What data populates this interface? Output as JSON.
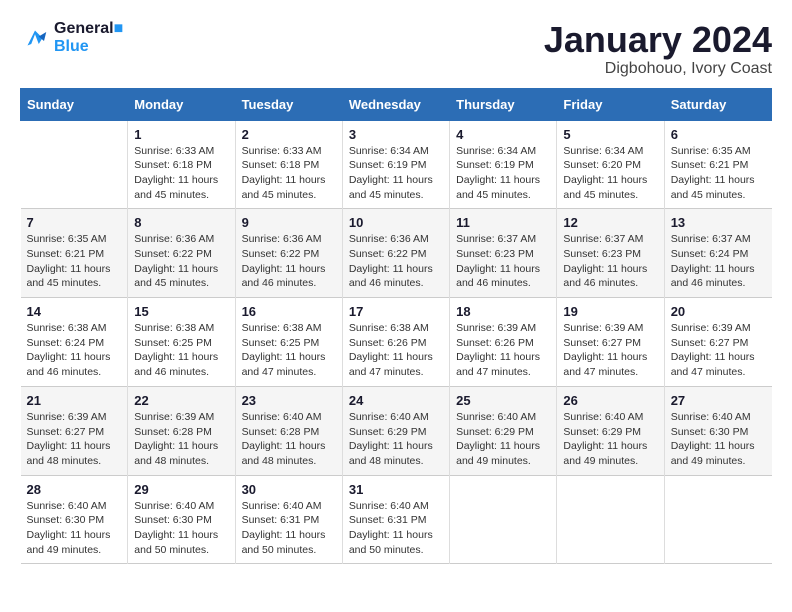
{
  "header": {
    "logo_line1": "General",
    "logo_line2": "Blue",
    "month": "January 2024",
    "location": "Digbohouo, Ivory Coast"
  },
  "weekdays": [
    "Sunday",
    "Monday",
    "Tuesday",
    "Wednesday",
    "Thursday",
    "Friday",
    "Saturday"
  ],
  "weeks": [
    [
      {
        "day": "",
        "info": ""
      },
      {
        "day": "1",
        "info": "Sunrise: 6:33 AM\nSunset: 6:18 PM\nDaylight: 11 hours and 45 minutes."
      },
      {
        "day": "2",
        "info": "Sunrise: 6:33 AM\nSunset: 6:18 PM\nDaylight: 11 hours and 45 minutes."
      },
      {
        "day": "3",
        "info": "Sunrise: 6:34 AM\nSunset: 6:19 PM\nDaylight: 11 hours and 45 minutes."
      },
      {
        "day": "4",
        "info": "Sunrise: 6:34 AM\nSunset: 6:19 PM\nDaylight: 11 hours and 45 minutes."
      },
      {
        "day": "5",
        "info": "Sunrise: 6:34 AM\nSunset: 6:20 PM\nDaylight: 11 hours and 45 minutes."
      },
      {
        "day": "6",
        "info": "Sunrise: 6:35 AM\nSunset: 6:21 PM\nDaylight: 11 hours and 45 minutes."
      }
    ],
    [
      {
        "day": "7",
        "info": "Sunrise: 6:35 AM\nSunset: 6:21 PM\nDaylight: 11 hours and 45 minutes."
      },
      {
        "day": "8",
        "info": "Sunrise: 6:36 AM\nSunset: 6:22 PM\nDaylight: 11 hours and 45 minutes."
      },
      {
        "day": "9",
        "info": "Sunrise: 6:36 AM\nSunset: 6:22 PM\nDaylight: 11 hours and 46 minutes."
      },
      {
        "day": "10",
        "info": "Sunrise: 6:36 AM\nSunset: 6:22 PM\nDaylight: 11 hours and 46 minutes."
      },
      {
        "day": "11",
        "info": "Sunrise: 6:37 AM\nSunset: 6:23 PM\nDaylight: 11 hours and 46 minutes."
      },
      {
        "day": "12",
        "info": "Sunrise: 6:37 AM\nSunset: 6:23 PM\nDaylight: 11 hours and 46 minutes."
      },
      {
        "day": "13",
        "info": "Sunrise: 6:37 AM\nSunset: 6:24 PM\nDaylight: 11 hours and 46 minutes."
      }
    ],
    [
      {
        "day": "14",
        "info": "Sunrise: 6:38 AM\nSunset: 6:24 PM\nDaylight: 11 hours and 46 minutes."
      },
      {
        "day": "15",
        "info": "Sunrise: 6:38 AM\nSunset: 6:25 PM\nDaylight: 11 hours and 46 minutes."
      },
      {
        "day": "16",
        "info": "Sunrise: 6:38 AM\nSunset: 6:25 PM\nDaylight: 11 hours and 47 minutes."
      },
      {
        "day": "17",
        "info": "Sunrise: 6:38 AM\nSunset: 6:26 PM\nDaylight: 11 hours and 47 minutes."
      },
      {
        "day": "18",
        "info": "Sunrise: 6:39 AM\nSunset: 6:26 PM\nDaylight: 11 hours and 47 minutes."
      },
      {
        "day": "19",
        "info": "Sunrise: 6:39 AM\nSunset: 6:27 PM\nDaylight: 11 hours and 47 minutes."
      },
      {
        "day": "20",
        "info": "Sunrise: 6:39 AM\nSunset: 6:27 PM\nDaylight: 11 hours and 47 minutes."
      }
    ],
    [
      {
        "day": "21",
        "info": "Sunrise: 6:39 AM\nSunset: 6:27 PM\nDaylight: 11 hours and 48 minutes."
      },
      {
        "day": "22",
        "info": "Sunrise: 6:39 AM\nSunset: 6:28 PM\nDaylight: 11 hours and 48 minutes."
      },
      {
        "day": "23",
        "info": "Sunrise: 6:40 AM\nSunset: 6:28 PM\nDaylight: 11 hours and 48 minutes."
      },
      {
        "day": "24",
        "info": "Sunrise: 6:40 AM\nSunset: 6:29 PM\nDaylight: 11 hours and 48 minutes."
      },
      {
        "day": "25",
        "info": "Sunrise: 6:40 AM\nSunset: 6:29 PM\nDaylight: 11 hours and 49 minutes."
      },
      {
        "day": "26",
        "info": "Sunrise: 6:40 AM\nSunset: 6:29 PM\nDaylight: 11 hours and 49 minutes."
      },
      {
        "day": "27",
        "info": "Sunrise: 6:40 AM\nSunset: 6:30 PM\nDaylight: 11 hours and 49 minutes."
      }
    ],
    [
      {
        "day": "28",
        "info": "Sunrise: 6:40 AM\nSunset: 6:30 PM\nDaylight: 11 hours and 49 minutes."
      },
      {
        "day": "29",
        "info": "Sunrise: 6:40 AM\nSunset: 6:30 PM\nDaylight: 11 hours and 50 minutes."
      },
      {
        "day": "30",
        "info": "Sunrise: 6:40 AM\nSunset: 6:31 PM\nDaylight: 11 hours and 50 minutes."
      },
      {
        "day": "31",
        "info": "Sunrise: 6:40 AM\nSunset: 6:31 PM\nDaylight: 11 hours and 50 minutes."
      },
      {
        "day": "",
        "info": ""
      },
      {
        "day": "",
        "info": ""
      },
      {
        "day": "",
        "info": ""
      }
    ]
  ]
}
